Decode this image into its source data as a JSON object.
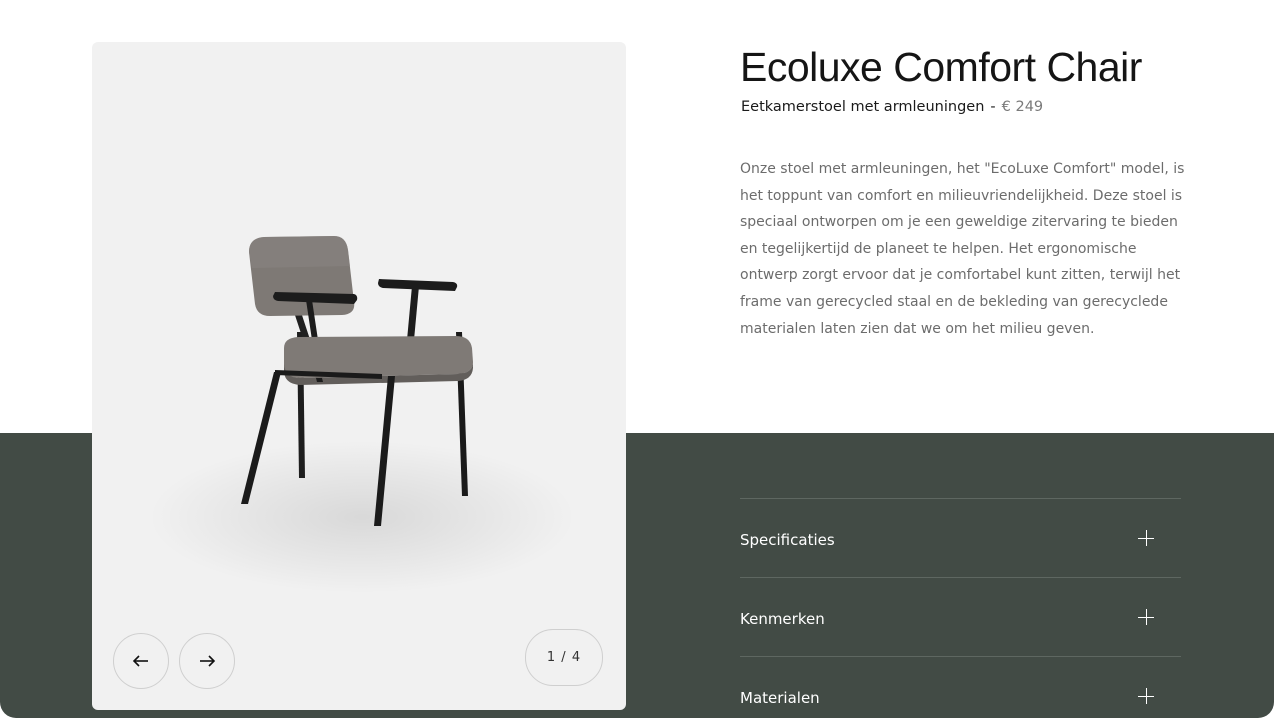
{
  "product": {
    "title": "Ecoluxe Comfort Chair",
    "subtitle": "Eetkamerstoel met armleuningen",
    "separator": "-",
    "price": "€ 249",
    "description": "Onze stoel met armleuningen, het \"EcoLuxe Comfort\" model, is het toppunt van comfort en milieuvriendelijkheid. Deze stoel is speciaal ontworpen om je een geweldige zitervaring te bieden en tegelijkertijd de planeet te helpen. Het ergonomische ontwerp zorgt ervoor dat je comfortabel kunt zitten, terwijl het frame van gerecycled staal en de bekleding van gerecyclede materialen laten zien dat we om het milieu geven."
  },
  "gallery": {
    "counter": "1 / 4",
    "prev_icon": "arrow-left-icon",
    "next_icon": "arrow-right-icon",
    "image": "chair-with-armrests"
  },
  "accordion": {
    "items": [
      {
        "label": "Specificaties"
      },
      {
        "label": "Kenmerken"
      },
      {
        "label": "Materialen"
      }
    ]
  },
  "colors": {
    "band": "#424b45",
    "gallery_bg": "#f1f1f1",
    "fabric": "#7d7874",
    "frame": "#1c1c1c"
  }
}
